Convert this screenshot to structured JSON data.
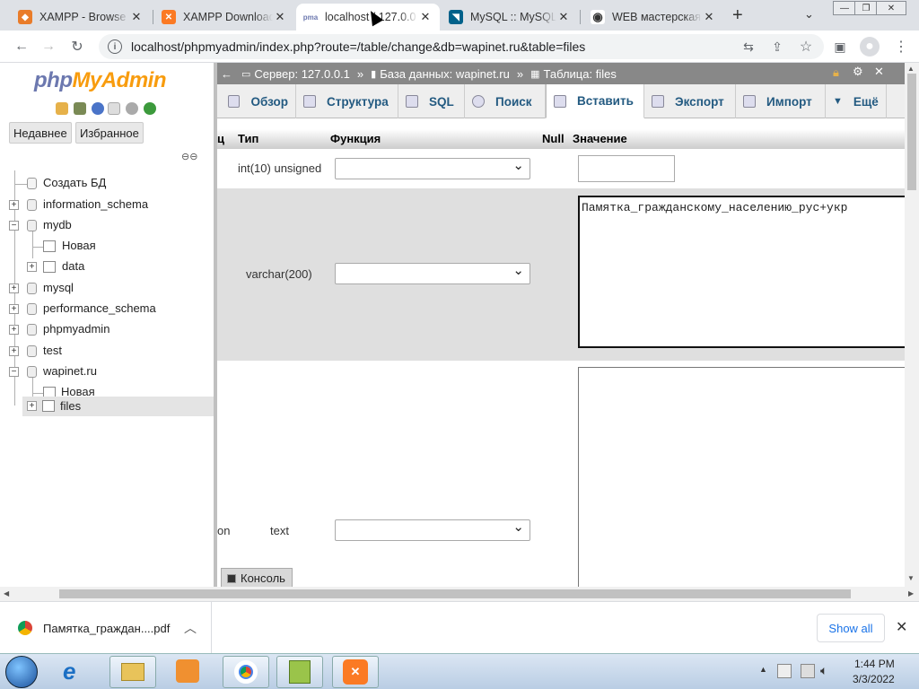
{
  "browser": {
    "tabs": [
      {
        "title": "XAMPP - Browse",
        "icon": "xampp-forum-icon",
        "color": "#e97c2a"
      },
      {
        "title": "XAMPP Download",
        "icon": "xampp-icon",
        "color": "#fb7a24"
      },
      {
        "title": "localhost / 127.0.0",
        "icon": "phpmyadmin-icon",
        "color": "#6c78af",
        "active": true
      },
      {
        "title": "MySQL :: MySQL",
        "icon": "mysql-icon",
        "color": "#00618a"
      },
      {
        "title": "WEB мастерская",
        "icon": "eye-icon",
        "color": "#444"
      }
    ],
    "url": "localhost/phpmyadmin/index.php?route=/table/change&db=wapinet.ru&table=files"
  },
  "pma": {
    "logo_part1": "php",
    "logo_part2": "MyAdmin",
    "recent_label": "Недавнее",
    "favorites_label": "Избранное",
    "tree": [
      {
        "label": "Создать БД",
        "level": 0,
        "kind": "new"
      },
      {
        "label": "information_schema",
        "level": 0,
        "kind": "db",
        "expander": "+"
      },
      {
        "label": "mydb",
        "level": 0,
        "kind": "db",
        "expander": "−"
      },
      {
        "label": "Новая",
        "level": 1,
        "kind": "new"
      },
      {
        "label": "data",
        "level": 1,
        "kind": "table",
        "expander": "+"
      },
      {
        "label": "mysql",
        "level": 0,
        "kind": "db",
        "expander": "+"
      },
      {
        "label": "performance_schema",
        "level": 0,
        "kind": "db",
        "expander": "+"
      },
      {
        "label": "phpmyadmin",
        "level": 0,
        "kind": "db",
        "expander": "+"
      },
      {
        "label": "test",
        "level": 0,
        "kind": "db",
        "expander": "+"
      },
      {
        "label": "wapinet.ru",
        "level": 0,
        "kind": "db",
        "expander": "−"
      },
      {
        "label": "Новая",
        "level": 1,
        "kind": "new"
      },
      {
        "label": "files",
        "level": 1,
        "kind": "table",
        "expander": "+"
      }
    ],
    "breadcrumb": {
      "server": "Сервер: 127.0.0.1",
      "database": "База данных: wapinet.ru",
      "table": "Таблица: files"
    },
    "nav_tabs": [
      "Обзор",
      "Структура",
      "SQL",
      "Поиск",
      "Вставить",
      "Экспорт",
      "Импорт",
      "Ещё"
    ],
    "columns": {
      "c0": "ц",
      "type": "Тип",
      "function": "Функция",
      "null": "Null",
      "value": "Значение"
    },
    "rows": [
      {
        "name": "",
        "type": "int(10) unsigned",
        "value": ""
      },
      {
        "name": "",
        "type": "varchar(200)",
        "value": "Памятка_гражданскому_населению_рус+укр"
      },
      {
        "name": "on",
        "type": "text",
        "value": ""
      }
    ],
    "console_label": "Консоль"
  },
  "downloads": {
    "file": "Памятка_граждан....pdf",
    "show_all": "Show all"
  },
  "taskbar": {
    "time": "1:44 PM",
    "date": "3/3/2022"
  }
}
